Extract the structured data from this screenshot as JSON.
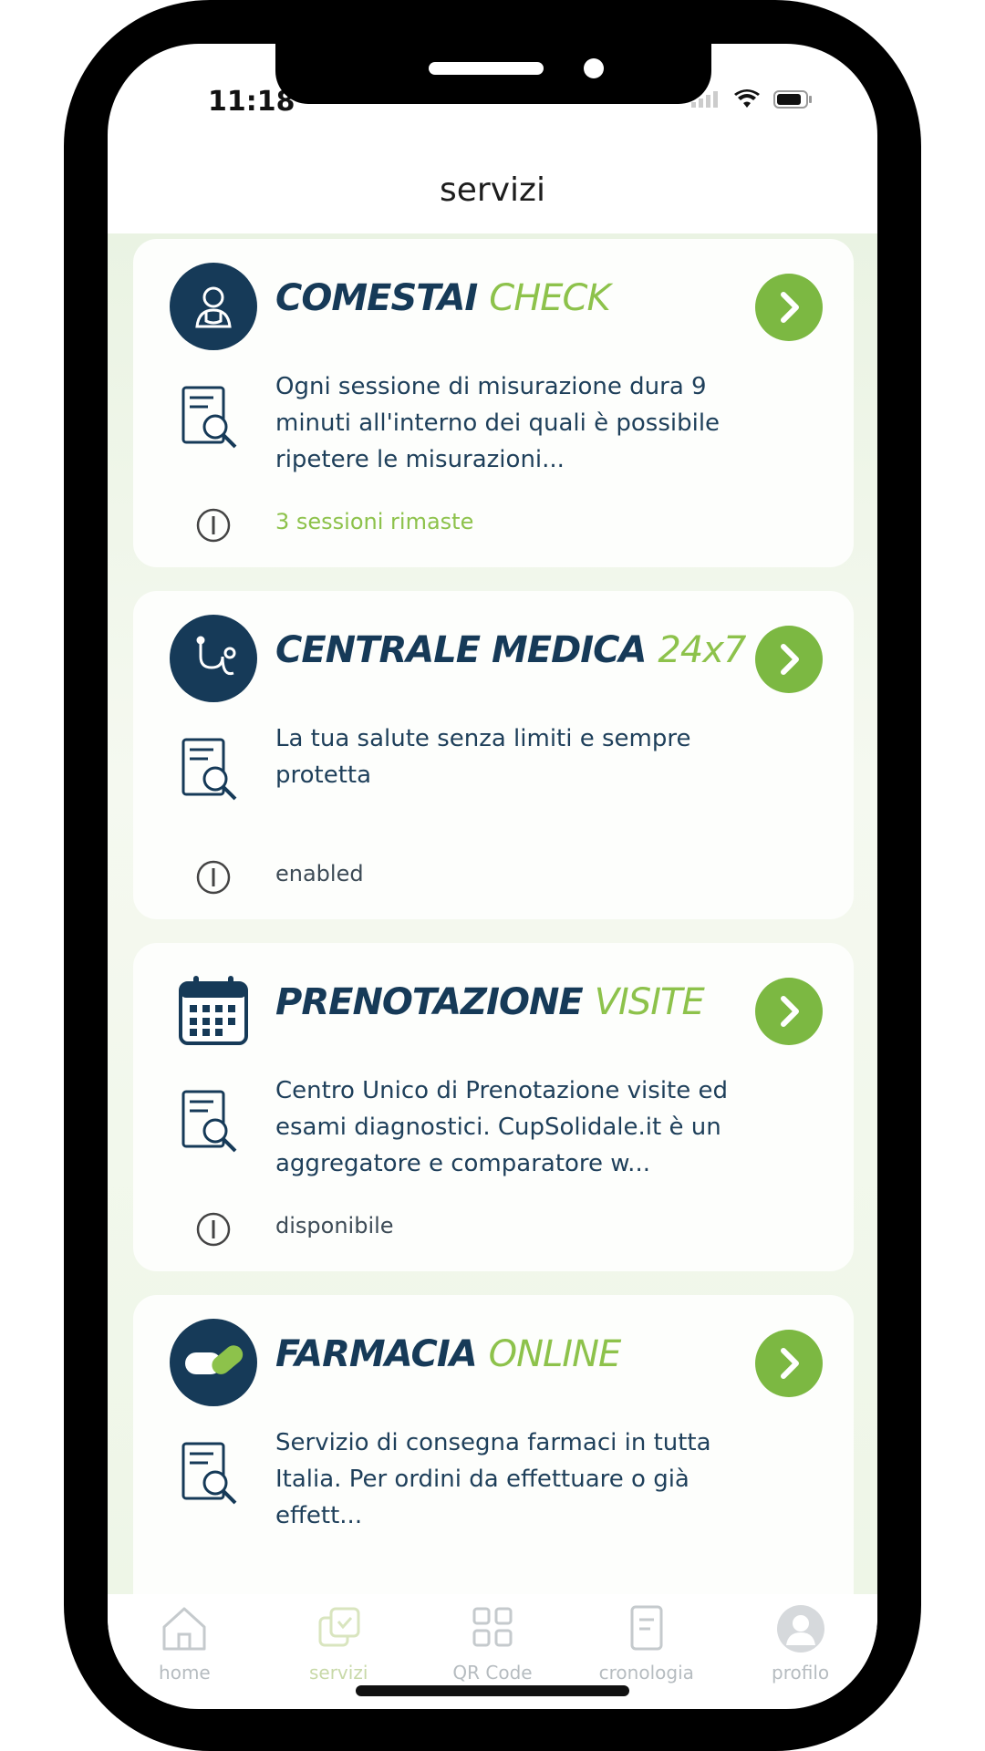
{
  "status_bar": {
    "time": "11:18"
  },
  "header": {
    "title": "servizi"
  },
  "cards": [
    {
      "title_main": "COMESTAI",
      "title_highlight": "CHECK",
      "description": "Ogni sessione di misurazione dura 9 minuti all'interno dei quali è possibile ripetere le misurazioni...",
      "status": "3 sessioni rimaste",
      "icon": "doctor-icon"
    },
    {
      "title_main": "CENTRALE MEDICA",
      "title_highlight": "24x7",
      "description": "La tua salute senza limiti e sempre protetta",
      "status": "enabled",
      "icon": "stethoscope-icon"
    },
    {
      "title_main": "PRENOTAZIONE",
      "title_highlight": "VISITE",
      "description": "Centro Unico di Prenotazione visite ed esami diagnostici. CupSolidale.it è un aggregatore e comparatore w...",
      "status": "disponibile",
      "icon": "calendar-icon"
    },
    {
      "title_main": "FARMACIA",
      "title_highlight": "ONLINE",
      "description": "Servizio di consegna farmaci in tutta Italia. Per ordini da effettuare o già effett...",
      "status": "",
      "icon": "pill-icon"
    }
  ],
  "tabbar": [
    {
      "label": "home",
      "icon": "home-icon"
    },
    {
      "label": "servizi",
      "icon": "services-icon",
      "active": true
    },
    {
      "label": "QR Code",
      "icon": "qr-code-icon"
    },
    {
      "label": "cronologia",
      "icon": "history-icon"
    },
    {
      "label": "profilo",
      "icon": "profile-icon"
    }
  ],
  "colors": {
    "navy": "#163a58",
    "green": "#7cb842",
    "light_green": "#8dc24b"
  }
}
